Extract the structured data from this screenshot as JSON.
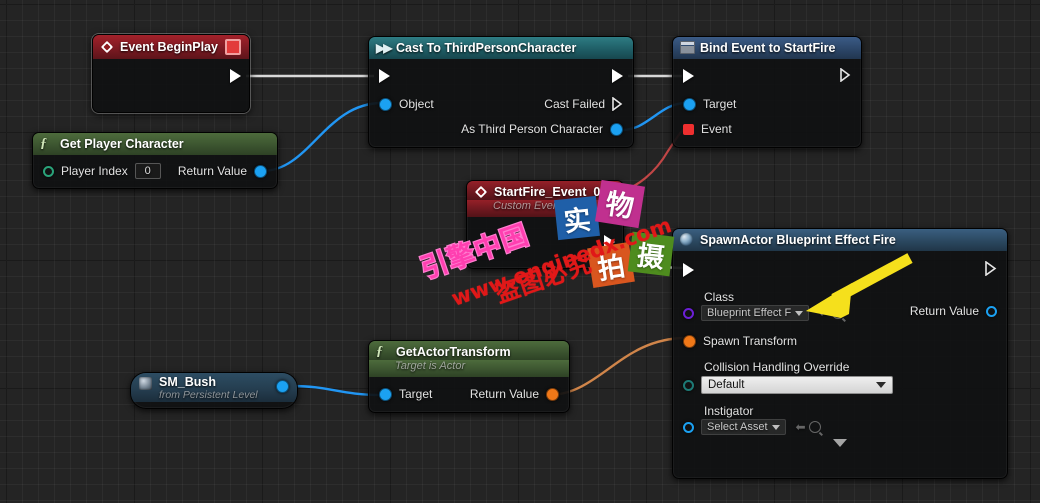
{
  "graph": {
    "app": "Unreal Engine Blueprint Event Graph",
    "background_color": "#242424",
    "grid_minor_color": "#2e2e2e",
    "grid_major_color": "#141414"
  },
  "nodes": {
    "event_begin_play": {
      "title": "Event BeginPlay",
      "icon": "event-diamond-icon",
      "header_color": "#7d1a22",
      "out_exec": "",
      "has_delegate_box": true
    },
    "cast_to_third_person": {
      "title": "Cast To ThirdPersonCharacter",
      "icon": "cast-arrows-icon",
      "header_color": "#1f5e66",
      "in_exec": "",
      "out_exec": "",
      "in_object": "Object",
      "out_cast_failed": "Cast Failed",
      "out_as_character": "As Third Person Character"
    },
    "bind_event_start_fire": {
      "title": "Bind Event to StartFire",
      "icon": "bind-grid-icon",
      "header_color": "#2c4668",
      "in_exec": "",
      "out_exec": "",
      "in_target": "Target",
      "in_event": "Event"
    },
    "get_player_character": {
      "title": "Get Player Character",
      "icon": "function-fx-icon",
      "header_color": "#3c5530",
      "in_player_index": "Player Index",
      "player_index_value": "0",
      "out_return_value": "Return Value"
    },
    "start_fire_event": {
      "title": "StartFire_Event_0",
      "subtitle": "Custom Event",
      "icon": "event-diamond-icon",
      "header_color": "#6f181f",
      "out_exec": ""
    },
    "spawn_actor": {
      "title": "SpawnActor Blueprint Effect Fire",
      "icon": "spawn-ball-icon",
      "header_color": "#2b4860",
      "in_exec": "",
      "out_exec": "",
      "class_label": "Class",
      "class_value": "Blueprint Effect F",
      "spawn_transform_label": "Spawn Transform",
      "collision_label": "Collision Handling Override",
      "collision_value": "Default",
      "instigator_label": "Instigator",
      "instigator_value": "Select Asset",
      "out_return_value": "Return Value",
      "expander": "expand-down-icon"
    },
    "get_actor_transform": {
      "title": "GetActorTransform",
      "subtitle": "Target is Actor",
      "icon": "function-fx-icon",
      "header_color": "#3c5530",
      "in_target": "Target",
      "out_return_value": "Return Value"
    },
    "sm_bush": {
      "title": "SM_Bush",
      "subtitle": "from Persistent Level",
      "icon": "actor-cube-icon",
      "header_color": "#243c4e",
      "out_value": ""
    }
  },
  "wires": [
    {
      "name": "beginplay-to-cast-exec",
      "type": "exec",
      "color": "#d8d8d8"
    },
    {
      "name": "player-char-to-cast-object",
      "type": "data",
      "color": "#2196f3"
    },
    {
      "name": "cast-exec-to-bind-exec",
      "type": "exec",
      "color": "#d8d8d8"
    },
    {
      "name": "cast-character-to-bind-target",
      "type": "data",
      "color": "#2196f3"
    },
    {
      "name": "startfire-event-to-bind-event",
      "type": "delegate",
      "color": "#c14646"
    },
    {
      "name": "startfire-exec-to-spawn-exec",
      "type": "exec",
      "color": "#d8d8d8"
    },
    {
      "name": "bush-to-getactortransform-target",
      "type": "data",
      "color": "#2196f3"
    },
    {
      "name": "transform-to-spawn-transform",
      "type": "data",
      "color": "#d0854a"
    }
  ],
  "annotation": {
    "arrow": {
      "name": "yellow-callout-arrow",
      "color": "#f5e01c",
      "points_at": "Class dropdown"
    }
  },
  "watermark": {
    "brand_outline": "引擎中国",
    "site": "www.enginedx.com",
    "notice": "盗图必究",
    "tiles": [
      {
        "char": "实",
        "color": "#1f5fa8"
      },
      {
        "char": "物",
        "color": "#c0308f"
      },
      {
        "char": "拍",
        "color": "#d9561f"
      },
      {
        "char": "摄",
        "color": "#4e8c1e"
      }
    ]
  }
}
